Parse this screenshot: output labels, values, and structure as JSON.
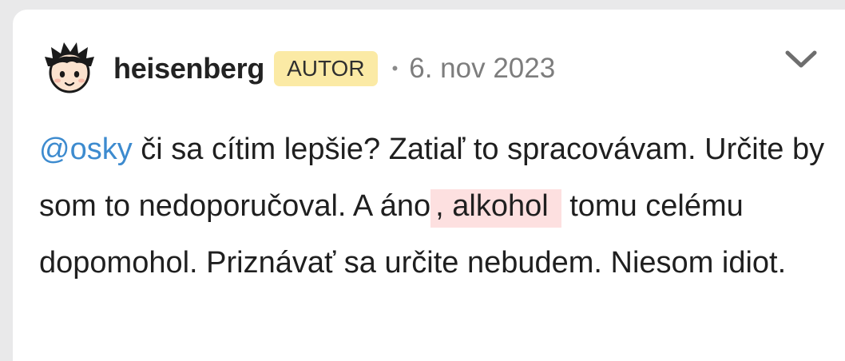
{
  "post": {
    "author": "heisenberg",
    "badge": "AUTOR",
    "separator": "•",
    "date": "6. nov 2023",
    "mention": "@osky",
    "text_part1": " či sa cítim lepšie? Zatiaľ to spracovávam. Určite by som to nedoporučoval. A áno",
    "highlight": ", alkohol",
    "text_part2": " tomu celému dopomohol. Priznávať sa určite nebudem. Niesom idiot."
  },
  "icons": {
    "avatar": "cartoon-face-avatar",
    "menu": "chevron-down-icon"
  },
  "colors": {
    "mention": "#3d8bcf",
    "badge_bg": "#fbeaa5",
    "highlight_bg": "#fde0e0",
    "date": "#7d7d7d"
  }
}
